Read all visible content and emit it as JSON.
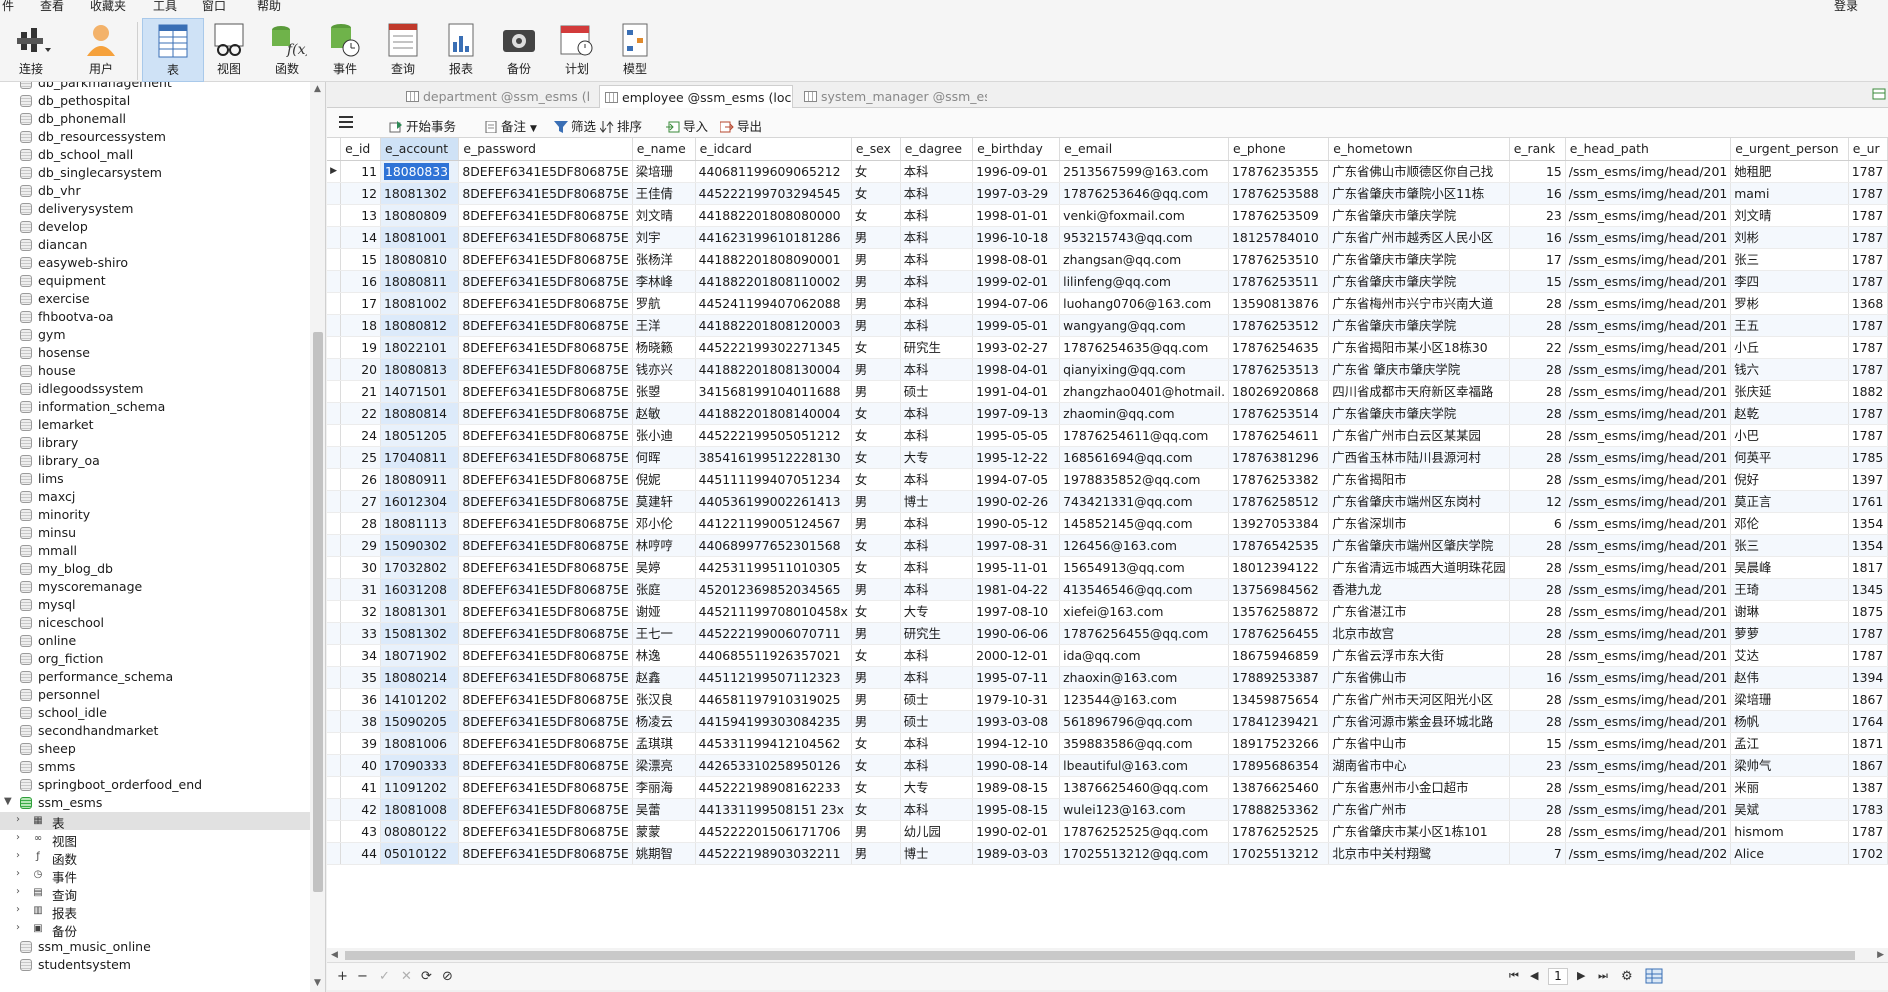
{
  "menu": {
    "items": [
      "件",
      "查看",
      "收藏夹",
      "工具",
      "窗口",
      "帮助"
    ],
    "login": "登录"
  },
  "toolbar": {
    "buttons": [
      {
        "label": "连接",
        "icon": "plug-icon"
      },
      {
        "label": "用户",
        "icon": "user-icon"
      },
      {
        "label": "表",
        "icon": "table-icon"
      },
      {
        "label": "视图",
        "icon": "view-icon"
      },
      {
        "label": "函数",
        "icon": "function-icon"
      },
      {
        "label": "事件",
        "icon": "event-icon"
      },
      {
        "label": "查询",
        "icon": "query-icon"
      },
      {
        "label": "报表",
        "icon": "report-icon"
      },
      {
        "label": "备份",
        "icon": "backup-icon"
      },
      {
        "label": "计划",
        "icon": "schedule-icon"
      },
      {
        "label": "模型",
        "icon": "model-icon"
      }
    ]
  },
  "sidebar": {
    "databases": [
      "db_parkmanagement",
      "db_pethospital",
      "db_phonemall",
      "db_resourcessystem",
      "db_school_mall",
      "db_singlecarsystem",
      "db_vhr",
      "deliverysystem",
      "develop",
      "diancan",
      "easyweb-shiro",
      "equipment",
      "exercise",
      "fhbootva-oa",
      "gym",
      "hosense",
      "house",
      "idlegoodssystem",
      "information_schema",
      "lemarket",
      "library",
      "library_oa",
      "lims",
      "maxcj",
      "minority",
      "minsu",
      "mmall",
      "my_blog_db",
      "myscoremanage",
      "mysql",
      "niceschool",
      "online",
      "org_fiction",
      "performance_schema",
      "personnel",
      "school_idle",
      "secondhandmarket",
      "sheep",
      "smms",
      "springboot_orderfood_end"
    ],
    "open_db": "ssm_esms",
    "children": [
      {
        "label": "表",
        "icon": "table-icon"
      },
      {
        "label": "视图",
        "icon": "view-icon"
      },
      {
        "label": "函数",
        "icon": "function-icon"
      },
      {
        "label": "事件",
        "icon": "event-icon"
      },
      {
        "label": "查询",
        "icon": "query-icon"
      },
      {
        "label": "报表",
        "icon": "report-icon"
      },
      {
        "label": "备份",
        "icon": "backup-icon"
      }
    ],
    "after": [
      "ssm_music_online",
      "studentsystem"
    ]
  },
  "tabs": [
    {
      "label": "department @ssm_esms (lo...",
      "active": false
    },
    {
      "label": "employee @ssm_esms (loca...",
      "active": true
    },
    {
      "label": "system_manager @ssm_es...",
      "active": false
    }
  ],
  "objbar": {
    "begin_tx": "开始事务",
    "note": "备注",
    "filter": "筛选",
    "sort": "排序",
    "import": "导入",
    "export": "导出"
  },
  "grid": {
    "columns": [
      "e_id",
      "e_account",
      "e_password",
      "e_name",
      "e_idcard",
      "e_sex",
      "e_dagree",
      "e_birthday",
      "e_email",
      "e_phone",
      "e_hometown",
      "e_rank",
      "e_head_path",
      "e_urgent_person",
      "e_ur"
    ],
    "rows": [
      [
        "11",
        "18080833",
        "8DEFEF6341E5DF806875E",
        "梁培珊",
        "440681199609065212",
        "女",
        "本科",
        "1996-09-01",
        "2513567599@163.com",
        "17876235355",
        "广东省佛山市顺德区你自己找",
        "15",
        "/ssm_esms/img/head/201",
        "她租肥",
        "1787"
      ],
      [
        "12",
        "18081302",
        "8DEFEF6341E5DF806875E",
        "王佳倩",
        "445222199703294545",
        "女",
        "本科",
        "1997-03-29",
        "17876253646@qq.com",
        "17876253588",
        "广东省肇庆市肇院小区11栋",
        "16",
        "/ssm_esms/img/head/201",
        "mami",
        "1787"
      ],
      [
        "13",
        "18080809",
        "8DEFEF6341E5DF806875E",
        "刘文晴",
        "441882201808080000",
        "女",
        "本科",
        "1998-01-01",
        "venki@foxmail.com",
        "17876253509",
        "广东省肇庆市肇庆学院",
        "23",
        "/ssm_esms/img/head/201",
        "刘文晴",
        "1787"
      ],
      [
        "14",
        "18081001",
        "8DEFEF6341E5DF806875E",
        "刘宇",
        "441623199610181286",
        "男",
        "本科",
        "1996-10-18",
        "953215743@qq.com",
        "18125784010",
        "广东省广州市越秀区人民小区",
        "16",
        "/ssm_esms/img/head/201",
        "刘彬",
        "1787"
      ],
      [
        "15",
        "18080810",
        "8DEFEF6341E5DF806875E",
        "张杨洋",
        "441882201808090001",
        "男",
        "本科",
        "1998-08-01",
        "zhangsan@qq.com",
        "17876253510",
        "广东省肇庆市肇庆学院",
        "17",
        "/ssm_esms/img/head/201",
        "张三",
        "1787"
      ],
      [
        "16",
        "18080811",
        "8DEFEF6341E5DF806875E",
        "李林峰",
        "441882201808110002",
        "男",
        "本科",
        "1999-02-01",
        "lilinfeng@qq.com",
        "17876253511",
        "广东省肇庆市肇庆学院",
        "15",
        "/ssm_esms/img/head/201",
        "李四",
        "1787"
      ],
      [
        "17",
        "18081002",
        "8DEFEF6341E5DF806875E",
        "罗航",
        "445241199407062088",
        "男",
        "本科",
        "1994-07-06",
        "luohang0706@163.com",
        "13590813876",
        "广东省梅州市兴宁市兴南大道",
        "28",
        "/ssm_esms/img/head/201",
        "罗彬",
        "1368"
      ],
      [
        "18",
        "18080812",
        "8DEFEF6341E5DF806875E",
        "王洋",
        "441882201808120003",
        "男",
        "本科",
        "1999-05-01",
        "wangyang@qq.com",
        "17876253512",
        "广东省肇庆市肇庆学院",
        "28",
        "/ssm_esms/img/head/201",
        "王五",
        "1787"
      ],
      [
        "19",
        "18022101",
        "8DEFEF6341E5DF806875E",
        "杨晓籁",
        "445222199302271345",
        "女",
        "研究生",
        "1993-02-27",
        "17876254635@qq.com",
        "17876254635",
        "广东省揭阳市某小区18栋30",
        "22",
        "/ssm_esms/img/head/201",
        "小丘",
        "1787"
      ],
      [
        "20",
        "18080813",
        "8DEFEF6341E5DF806875E",
        "钱亦兴",
        "441882201808130004",
        "男",
        "本科",
        "1998-04-01",
        "qianyixing@qq.com",
        "17876253513",
        "广东省 肇庆市肇庆学院",
        "28",
        "/ssm_esms/img/head/201",
        "钱六",
        "1787"
      ],
      [
        "21",
        "14071501",
        "8DEFEF6341E5DF806875E",
        "张曌",
        "341568199104011688",
        "男",
        "硕士",
        "1991-04-01",
        "zhangzhao0401@hotmail.",
        "18026920868",
        "四川省成都市天府新区幸福路",
        "28",
        "/ssm_esms/img/head/201",
        "张庆延",
        "1882"
      ],
      [
        "22",
        "18080814",
        "8DEFEF6341E5DF806875E",
        "赵敏",
        "441882201808140004",
        "女",
        "本科",
        "1997-09-13",
        "zhaomin@qq.com",
        "17876253514",
        "广东省肇庆市肇庆学院",
        "28",
        "/ssm_esms/img/head/201",
        "赵乾",
        "1787"
      ],
      [
        "24",
        "18051205",
        "8DEFEF6341E5DF806875E",
        "张小迪",
        "445222199505051212",
        "女",
        "本科",
        "1995-05-05",
        "17876254611@qq.com",
        "17876254611",
        "广东省广州市白云区某某园",
        "28",
        "/ssm_esms/img/head/201",
        "小巴",
        "1787"
      ],
      [
        "25",
        "17040811",
        "8DEFEF6341E5DF806875E",
        "何晖",
        "385416199512228130",
        "女",
        "大专",
        "1995-12-22",
        "168561694@qq.com",
        "17876381296",
        "广西省玉林市陆川县源河村",
        "28",
        "/ssm_esms/img/head/201",
        "何英平",
        "1785"
      ],
      [
        "26",
        "18080911",
        "8DEFEF6341E5DF806875E",
        "倪妮",
        "445111199407051234",
        "女",
        "本科",
        "1994-07-05",
        "1978835852@qq.com",
        "17876253382",
        "广东省揭阳市",
        "28",
        "/ssm_esms/img/head/201",
        "倪好",
        "1397"
      ],
      [
        "27",
        "16012304",
        "8DEFEF6341E5DF806875E",
        "莫建轩",
        "440536199002261413",
        "男",
        "博士",
        "1990-02-26",
        "743421331@qq.com",
        "17876258512",
        "广东省肇庆市端州区东岗村",
        "12",
        "/ssm_esms/img/head/201",
        "莫正言",
        "1761"
      ],
      [
        "28",
        "18081113",
        "8DEFEF6341E5DF806875E",
        "邓小伦",
        "441221199005124567",
        "男",
        "本科",
        "1990-05-12",
        "145852145@qq.com",
        "13927053384",
        "广东省深圳市",
        "6",
        "/ssm_esms/img/head/201",
        "邓伦",
        "1354"
      ],
      [
        "29",
        "15090302",
        "8DEFEF6341E5DF806875E",
        "林哼哼",
        "440689977652301568",
        "女",
        "本科",
        "1997-08-31",
        "126456@163.com",
        "17876542535",
        "广东省肇庆市端州区肇庆学院",
        "28",
        "/ssm_esms/img/head/201",
        "张三",
        "1354"
      ],
      [
        "30",
        "17032802",
        "8DEFEF6341E5DF806875E",
        "吴婷",
        "442531199511010305",
        "女",
        "本科",
        "1995-11-01",
        "15654913@qq.com",
        "18012394122",
        "广东省清远市城西大道明珠花园",
        "28",
        "/ssm_esms/img/head/201",
        "吴晨峰",
        "1817"
      ],
      [
        "31",
        "16031208",
        "8DEFEF6341E5DF806875E",
        "张庭",
        "452012369852034565",
        "男",
        "本科",
        "1981-04-22",
        "413546546@qq.com",
        "13756984562",
        "香港九龙",
        "28",
        "/ssm_esms/img/head/201",
        "王琦",
        "1345"
      ],
      [
        "32",
        "18081301",
        "8DEFEF6341E5DF806875E",
        "谢娅",
        "445211199708010458x",
        "女",
        "大专",
        "1997-08-10",
        "xiefei@163.com",
        "13576258872",
        "广东省湛江市",
        "28",
        "/ssm_esms/img/head/201",
        "谢琳",
        "1875"
      ],
      [
        "33",
        "15081302",
        "8DEFEF6341E5DF806875E",
        "王七一",
        "445222199006070711",
        "男",
        "研究生",
        "1990-06-06",
        "17876256455@qq.com",
        "17876256455",
        "北京市故宫",
        "28",
        "/ssm_esms/img/head/201",
        "萝萝",
        "1787"
      ],
      [
        "34",
        "18071902",
        "8DEFEF6341E5DF806875E",
        "林逸",
        "440685511926357021",
        "女",
        "本科",
        "2000-12-01",
        "ida@qq.com",
        "18675946859",
        "广东省云浮市东大街",
        "28",
        "/ssm_esms/img/head/201",
        "艾达",
        "1787"
      ],
      [
        "35",
        "18080214",
        "8DEFEF6341E5DF806875E",
        "赵鑫",
        "445112199507112323",
        "男",
        "本科",
        "1995-07-11",
        "zhaoxin@163.com",
        "17889253387",
        "广东省佛山市",
        "16",
        "/ssm_esms/img/head/201",
        "赵伟",
        "1394"
      ],
      [
        "36",
        "14101202",
        "8DEFEF6341E5DF806875E",
        "张汉良",
        "446581197910319025",
        "男",
        "硕士",
        "1979-10-31",
        "123544@163.com",
        "13459875654",
        "广东省广州市天河区阳光小区",
        "28",
        "/ssm_esms/img/head/201",
        "梁培珊",
        "1867"
      ],
      [
        "38",
        "15090205",
        "8DEFEF6341E5DF806875E",
        "杨凌云",
        "441594199303084235",
        "男",
        "硕士",
        "1993-03-08",
        "561896796@qq.com",
        "17841239421",
        "广东省河源市紫金县环城北路",
        "28",
        "/ssm_esms/img/head/201",
        "杨帆",
        "1764"
      ],
      [
        "39",
        "18081006",
        "8DEFEF6341E5DF806875E",
        "孟琪琪",
        "445331199412104562",
        "女",
        "本科",
        "1994-12-10",
        "359883586@qq.com",
        "18917523266",
        "广东省中山市",
        "15",
        "/ssm_esms/img/head/201",
        "孟江",
        "1871"
      ],
      [
        "40",
        "17090333",
        "8DEFEF6341E5DF806875E",
        "梁漂亮",
        "442653310258950126",
        "女",
        "本科",
        "1990-08-14",
        "lbeautiful@163.com",
        "17895686354",
        "湖南省市中心",
        "23",
        "/ssm_esms/img/head/201",
        "梁帅气",
        "1867"
      ],
      [
        "41",
        "11091202",
        "8DEFEF6341E5DF806875E",
        "李丽海",
        "445222198908162233",
        "女",
        "大专",
        "1989-08-15",
        "13876625460@qq.com",
        "13876625460",
        "广东省惠州市小金口超市",
        "28",
        "/ssm_esms/img/head/201",
        "米丽",
        "1387"
      ],
      [
        "42",
        "18081008",
        "8DEFEF6341E5DF806875E",
        "吴蕾",
        "441331199508151 23x",
        "女",
        "本科",
        "1995-08-15",
        "wulei123@163.com",
        "17888253362",
        "广东省广州市",
        "28",
        "/ssm_esms/img/head/201",
        "吴斌",
        "1783"
      ],
      [
        "43",
        "08080122",
        "8DEFEF6341E5DF806875E",
        "蒙蒙",
        "445222201506171706",
        "男",
        "幼儿园",
        "1990-02-01",
        "17876252525@qq.com",
        "17876252525",
        "广东省肇庆市某小区1栋101",
        "28",
        "/ssm_esms/img/head/201",
        "hismom",
        "1787"
      ],
      [
        "44",
        "05010122",
        "8DEFEF6341E5DF806875E",
        "姚期智",
        "445222198903032211",
        "男",
        "博士",
        "1989-03-03",
        "17025513212@qq.com",
        "17025513212",
        "北京市中关村翔鹭",
        "7",
        "/ssm_esms/img/head/202",
        "Alice",
        "1702"
      ]
    ]
  },
  "status": {
    "page": "1"
  }
}
